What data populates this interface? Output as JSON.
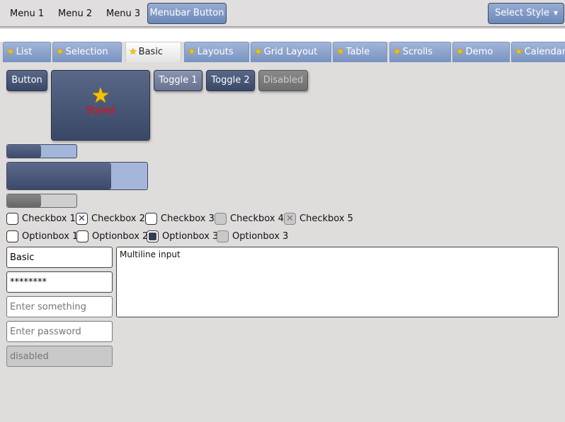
{
  "menubar": {
    "items": [
      "Menu 1",
      "Menu 2",
      "Menu 3"
    ],
    "button": "Menubar Button",
    "select_style": "Select Style"
  },
  "tabs": [
    {
      "label": "List"
    },
    {
      "label": "Selection"
    },
    {
      "label": "Basic",
      "active": true
    },
    {
      "label": "Layouts"
    },
    {
      "label": "Grid Layout"
    },
    {
      "label": "Table"
    },
    {
      "label": "Scrolls"
    },
    {
      "label": "Demo"
    },
    {
      "label": "Calendar"
    }
  ],
  "buttons": {
    "button": "Button",
    "styled": "Styled",
    "toggle1": "Toggle 1",
    "toggle2": "Toggle 2",
    "disabled": "Disabled"
  },
  "progress": [
    0.49,
    0.74,
    0.49
  ],
  "checkboxes": [
    {
      "label": "Checkbox 1",
      "checked": false
    },
    {
      "label": "Checkbox 2",
      "checked": true
    },
    {
      "label": "Checkbox 3",
      "checked": false
    },
    {
      "label": "Checkbox 4",
      "checked": false,
      "disabled": true
    },
    {
      "label": "Checkbox 5",
      "checked": true,
      "disabled": true
    }
  ],
  "options": [
    {
      "label": "Optionbox 1"
    },
    {
      "label": "Optionbox 2"
    },
    {
      "label": "Optionbox 3",
      "selected": true
    },
    {
      "label": "Optionbox 3",
      "disabled": true
    }
  ],
  "inputs": {
    "basic": "Basic",
    "password": "********",
    "placeholder1": "Enter something",
    "placeholder2": "Enter password",
    "disabled": "disabled",
    "multiline": "Multiline input"
  },
  "colors": {
    "accent": "#7893c1",
    "dark_button": "#3a4868",
    "styled_text": "#ff0000"
  }
}
